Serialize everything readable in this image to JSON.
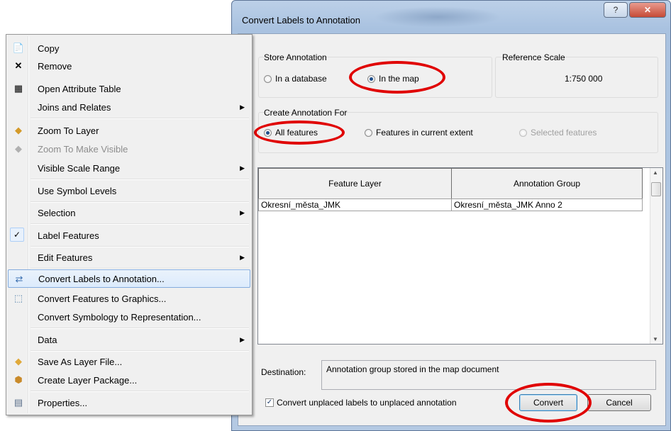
{
  "dialog": {
    "title": "Convert Labels to Annotation",
    "help_label": "?",
    "close_label": "✕",
    "store_annotation": {
      "label": "Store Annotation",
      "options": [
        "In a database",
        "In the map"
      ],
      "selected": "In the map"
    },
    "reference_scale": {
      "label": "Reference Scale",
      "value": "1:750 000"
    },
    "create_for": {
      "label": "Create Annotation For",
      "options": [
        "All features",
        "Features in current extent",
        "Selected features"
      ],
      "selected": "All features",
      "disabled": [
        "Selected features"
      ]
    },
    "grid": {
      "columns": [
        "Feature Layer",
        "Annotation Group"
      ],
      "rows": [
        [
          "Okresní_města_JMK",
          "Okresní_města_JMK Anno 2"
        ]
      ]
    },
    "destination": {
      "label": "Destination:",
      "value": "Annotation group stored in the map document"
    },
    "unplaced": {
      "label": "Convert unplaced labels to unplaced annotation",
      "checked": true
    },
    "convert_label": "Convert",
    "cancel_label": "Cancel",
    "highlight_color": "#e00000"
  },
  "menu": {
    "items": [
      {
        "label": "Copy",
        "icon": "copy-icon",
        "submenu": false
      },
      {
        "label": "Remove",
        "icon": "remove-x-icon",
        "submenu": false
      },
      {
        "label": "Open Attribute Table",
        "icon": "table-icon",
        "submenu": false
      },
      {
        "label": "Joins and Relates",
        "icon": "",
        "submenu": true
      },
      {
        "label": "Zoom To Layer",
        "icon": "zoom-to-layer-icon",
        "submenu": false
      },
      {
        "label": "Zoom To Make Visible",
        "icon": "zoom-visible-icon",
        "submenu": false,
        "disabled": true
      },
      {
        "label": "Visible Scale Range",
        "icon": "",
        "submenu": true
      },
      {
        "label": "Use Symbol Levels",
        "icon": "",
        "submenu": false
      },
      {
        "label": "Selection",
        "icon": "",
        "submenu": true
      },
      {
        "label": "Label Features",
        "icon": "check-icon",
        "submenu": false,
        "checked": true
      },
      {
        "label": "Edit Features",
        "icon": "",
        "submenu": true
      },
      {
        "label": "Convert Labels to Annotation...",
        "icon": "convert-labels-icon",
        "submenu": false,
        "highlighted": true
      },
      {
        "label": "Convert Features to Graphics...",
        "icon": "convert-graphics-icon",
        "submenu": false
      },
      {
        "label": "Convert Symbology to Representation...",
        "icon": "",
        "submenu": false
      },
      {
        "label": "Data",
        "icon": "",
        "submenu": true
      },
      {
        "label": "Save As Layer File...",
        "icon": "layer-file-icon",
        "submenu": false
      },
      {
        "label": "Create Layer Package...",
        "icon": "layer-package-icon",
        "submenu": false
      },
      {
        "label": "Properties...",
        "icon": "properties-icon",
        "submenu": false
      }
    ]
  }
}
